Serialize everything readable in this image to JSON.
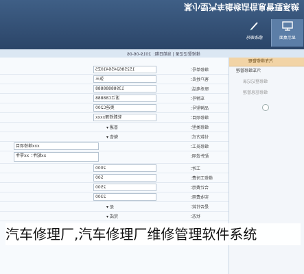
{
  "app": {
    "title": "某小型汽车维修店信息管理系统"
  },
  "toolbar": {
    "buttons": [
      {
        "label": "显示桌面",
        "icon": "monitor-icon"
      },
      {
        "label": "修改密码",
        "icon": "pencil-icon"
      }
    ]
  },
  "breadcrumb": {
    "text": "维修登记记录 | 当前日期：2019-06-06"
  },
  "form": {
    "rows": [
      {
        "label": "维修单号：",
        "value": "1525862456410ZS",
        "kind": "text"
      },
      {
        "label": "客户姓名：",
        "value": "张三",
        "kind": "text"
      },
      {
        "label": "联系电话：",
        "value": "13988888888",
        "kind": "text"
      },
      {
        "label": "车牌号：",
        "value": "浙江C88888",
        "kind": "text"
      },
      {
        "label": "品牌型号：",
        "value": "奥迪C200",
        "kind": "text"
      },
      {
        "label": "维修项目：",
        "value": "轮毂修理xxxx",
        "kind": "text"
      },
      {
        "label": "维修类型：",
        "value": "普通",
        "kind": "select"
      },
      {
        "label": "付款方式：",
        "value": "微信",
        "kind": "select"
      },
      {
        "label": "维修员工：",
        "value": "xxx维修项目",
        "kind": "text"
      },
      {
        "label": "配件说明：",
        "value": "xx配件：xx零件",
        "kind": "textarea"
      },
      {
        "label": "工时：",
        "value": "2000",
        "kind": "text"
      },
      {
        "label": "维修工时费：",
        "value": "500",
        "kind": "text"
      },
      {
        "label": "合计费用：",
        "value": "2500",
        "kind": "text"
      },
      {
        "label": "实收费用：",
        "value": "2300",
        "kind": "text"
      },
      {
        "label": "是否付款：",
        "value": "是",
        "kind": "select"
      },
      {
        "label": "状态：",
        "value": "完成",
        "kind": "select"
      }
    ]
  },
  "sidebar": {
    "header": "汽车维修管理",
    "items": [
      {
        "label": "汽车维修管理",
        "sub": false
      },
      {
        "label": "维修登记记录",
        "sub": true
      },
      {
        "label": "维修信息管理",
        "sub": true
      }
    ]
  },
  "caption": {
    "text": "汽车修理厂,汽车修理厂维修管理软件系统"
  }
}
